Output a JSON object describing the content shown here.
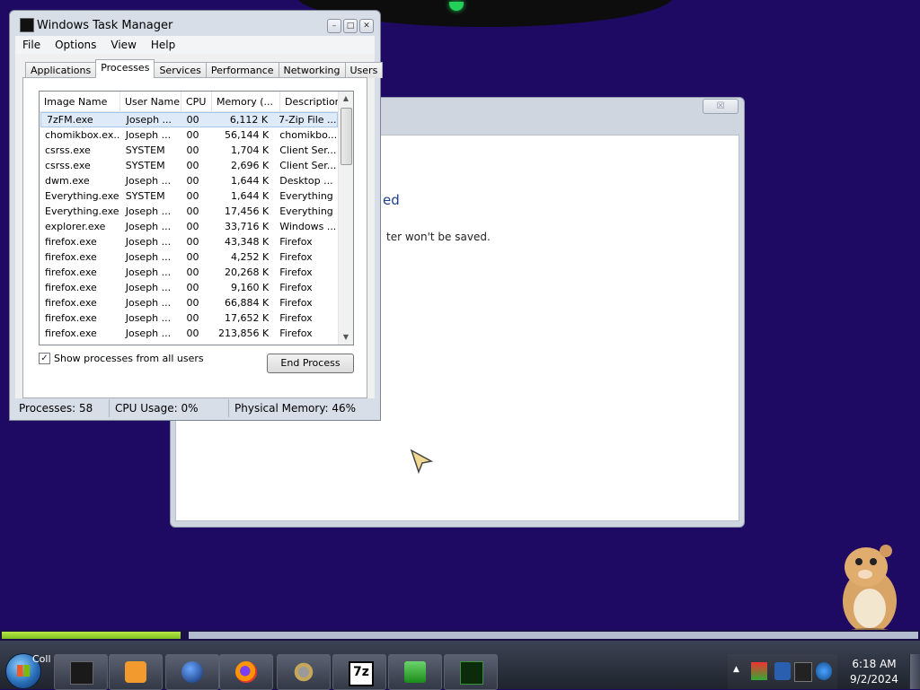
{
  "background_dialog": {
    "text_heading_fragment": "ed",
    "text_body_fragment": "ter won't be saved.",
    "close_glyph": "☒"
  },
  "task_manager": {
    "title": "Windows Task Manager",
    "menu": [
      "File",
      "Options",
      "View",
      "Help"
    ],
    "tabs": [
      "Applications",
      "Processes",
      "Services",
      "Performance",
      "Networking",
      "Users"
    ],
    "active_tab": "Processes",
    "columns": [
      "Image Name",
      "User Name",
      "CPU",
      "Memory (...",
      "Description"
    ],
    "rows": [
      [
        "7zFM.exe",
        "Joseph ...",
        "00",
        "6,112 K",
        "7-Zip File ..."
      ],
      [
        "chomikbox.ex...",
        "Joseph ...",
        "00",
        "56,144 K",
        "chomikbo..."
      ],
      [
        "csrss.exe",
        "SYSTEM",
        "00",
        "1,704 K",
        "Client Ser..."
      ],
      [
        "csrss.exe",
        "SYSTEM",
        "00",
        "2,696 K",
        "Client Ser..."
      ],
      [
        "dwm.exe",
        "Joseph ...",
        "00",
        "1,644 K",
        "Desktop ..."
      ],
      [
        "Everything.exe",
        "SYSTEM",
        "00",
        "1,644 K",
        "Everything"
      ],
      [
        "Everything.exe",
        "Joseph ...",
        "00",
        "17,456 K",
        "Everything"
      ],
      [
        "explorer.exe",
        "Joseph ...",
        "00",
        "33,716 K",
        "Windows ..."
      ],
      [
        "firefox.exe",
        "Joseph ...",
        "00",
        "43,348 K",
        "Firefox"
      ],
      [
        "firefox.exe",
        "Joseph ...",
        "00",
        "4,252 K",
        "Firefox"
      ],
      [
        "firefox.exe",
        "Joseph ...",
        "00",
        "20,268 K",
        "Firefox"
      ],
      [
        "firefox.exe",
        "Joseph ...",
        "00",
        "9,160 K",
        "Firefox"
      ],
      [
        "firefox.exe",
        "Joseph ...",
        "00",
        "66,884 K",
        "Firefox"
      ],
      [
        "firefox.exe",
        "Joseph ...",
        "00",
        "17,652 K",
        "Firefox"
      ],
      [
        "firefox.exe",
        "Joseph ...",
        "00",
        "213,856 K",
        "Firefox"
      ]
    ],
    "selected_row": 0,
    "show_all_label": "Show processes from all users",
    "show_all_checked": true,
    "end_process_label": "End Process",
    "status": {
      "processes": "Processes: 58",
      "cpu": "CPU Usage: 0%",
      "memory": "Physical Memory: 46%"
    }
  },
  "taskbar": {
    "start_label_fragment": "Coll",
    "clock_time": "6:18 AM",
    "clock_date": "9/2/2024",
    "progress_fraction": 0.195,
    "pinned": [
      "black-box-icon",
      "media-player-icon",
      "globe-icon",
      "firefox-icon",
      "gears-icon",
      "7zip-icon",
      "green-app-icon",
      "task-manager-graph-icon"
    ],
    "icon_7z_text": "7z"
  },
  "colors": {
    "desktop": "#1e0a63",
    "progress_green": "#8fd12a",
    "selection": "#dfeaf8"
  }
}
